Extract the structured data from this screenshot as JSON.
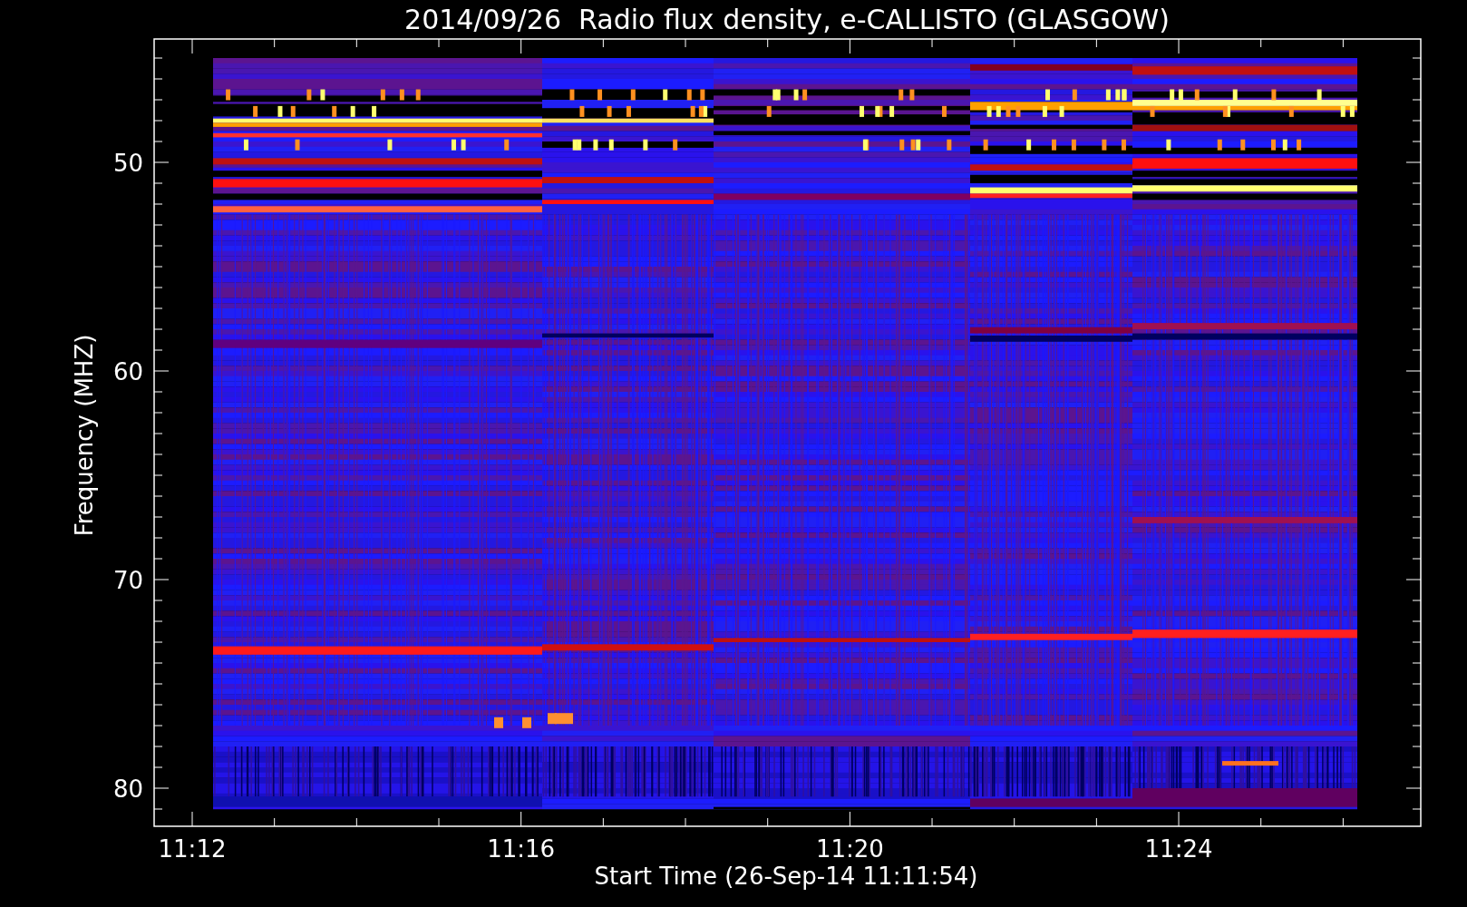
{
  "title": "2014/09/26  Radio flux density, e-CALLISTO (GLASGOW)",
  "y_axis": {
    "label": "Frequency (MHZ)",
    "tick_labels": [
      "50",
      "60",
      "70",
      "80"
    ]
  },
  "x_axis": {
    "label": "Start Time (26-Sep-14 11:11:54)",
    "tick_labels": [
      "11:12",
      "11:16",
      "11:20",
      "11:24"
    ]
  }
}
